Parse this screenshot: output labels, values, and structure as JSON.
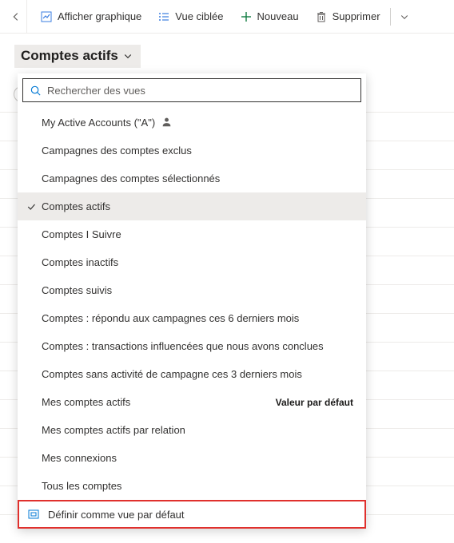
{
  "toolbar": {
    "show_chart": "Afficher graphique",
    "focused_view": "Vue ciblée",
    "new": "Nouveau",
    "delete": "Supprimer"
  },
  "view_selector": {
    "label": "Comptes actifs"
  },
  "search": {
    "placeholder": "Rechercher des vues"
  },
  "views": [
    {
      "label": "My Active Accounts (\"A\")",
      "personal": true
    },
    {
      "label": "Campagnes des comptes exclus"
    },
    {
      "label": "Campagnes des comptes sélectionnés"
    },
    {
      "label": "Comptes actifs",
      "selected": true
    },
    {
      "label": "Comptes I Suivre"
    },
    {
      "label": "Comptes inactifs"
    },
    {
      "label": "Comptes suivis"
    },
    {
      "label": "Comptes : répondu aux campagnes ces 6 derniers mois"
    },
    {
      "label": "Comptes : transactions influencées que nous avons conclues"
    },
    {
      "label": "Comptes sans activité de campagne ces 3 derniers mois"
    },
    {
      "label": "Mes comptes actifs",
      "default_label": "Valeur par défaut"
    },
    {
      "label": "Mes comptes actifs par relation"
    },
    {
      "label": "Mes connexions"
    },
    {
      "label": "Tous les comptes"
    }
  ],
  "footer": {
    "set_default": "Définir comme vue par défaut"
  }
}
